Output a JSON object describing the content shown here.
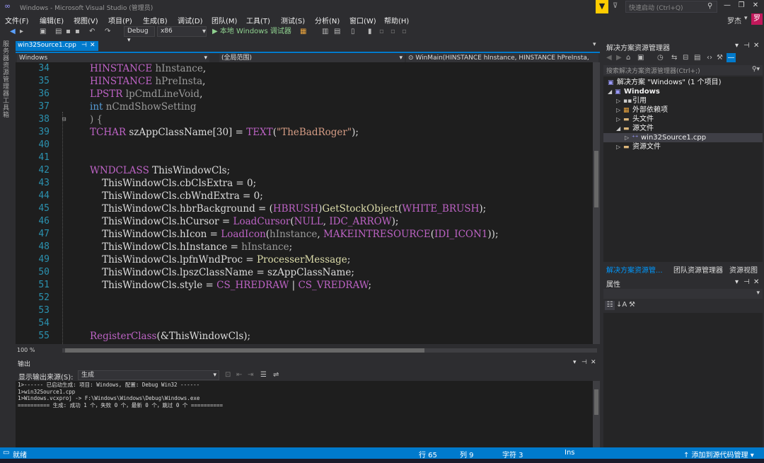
{
  "window": {
    "title": "Windows - Microsoft Visual Studio (管理员)",
    "quick_launch_placeholder": "快速启动 (Ctrl+Q)",
    "user_name": "罗杰",
    "avatar_letter": "罗"
  },
  "menu": [
    "文件(F)",
    "编辑(E)",
    "视图(V)",
    "项目(P)",
    "生成(B)",
    "调试(D)",
    "团队(M)",
    "工具(T)",
    "测试(S)",
    "分析(N)",
    "窗口(W)",
    "帮助(H)"
  ],
  "toolbar": {
    "config": "Debug",
    "platform": "x86",
    "run_label": "▶ 本地 Windows 调试器"
  },
  "left_strip_label": "服务器资源管理器工具箱",
  "editor": {
    "tab_name": "win32Source1.cpp",
    "nav_project": "Windows",
    "nav_scope": "(全局范围)",
    "nav_function": "WinMain(HINSTANCE hInstance, HINSTANCE hPreInsta,",
    "zoom": "100 %",
    "lines": [
      {
        "n": "34",
        "tokens": [
          {
            "t": "HINSTANCE",
            "c": "mac"
          },
          {
            "t": " "
          },
          {
            "t": "hInstance",
            "c": "par"
          },
          {
            "t": ","
          }
        ]
      },
      {
        "n": "35",
        "tokens": [
          {
            "t": "HINSTANCE",
            "c": "mac"
          },
          {
            "t": " "
          },
          {
            "t": "hPreInsta",
            "c": "par"
          },
          {
            "t": ","
          }
        ]
      },
      {
        "n": "36",
        "tokens": [
          {
            "t": "LPSTR",
            "c": "mac"
          },
          {
            "t": " "
          },
          {
            "t": "lpCmdLineVoid",
            "c": "par"
          },
          {
            "t": ","
          }
        ]
      },
      {
        "n": "37",
        "tokens": [
          {
            "t": "int",
            "c": "kw"
          },
          {
            "t": " "
          },
          {
            "t": "nCmdShowSetting",
            "c": "par"
          }
        ]
      },
      {
        "n": "38",
        "tokens": [
          {
            "t": ") {",
            "c": "par"
          }
        ]
      },
      {
        "n": "39",
        "tokens": [
          {
            "t": "TCHAR",
            "c": "mac"
          },
          {
            "t": " szAppClassName[30] = "
          },
          {
            "t": "TEXT",
            "c": "mac"
          },
          {
            "t": "("
          },
          {
            "t": "\"TheBadRoger\"",
            "c": "str"
          },
          {
            "t": ");"
          }
        ]
      },
      {
        "n": "40",
        "tokens": []
      },
      {
        "n": "41",
        "tokens": []
      },
      {
        "n": "42",
        "tokens": [
          {
            "t": "WNDCLASS",
            "c": "mac"
          },
          {
            "t": " ThisWindowCls;"
          }
        ]
      },
      {
        "n": "43",
        "tokens": [
          {
            "t": "    ThisWindowCls.cbClsExtra = 0;"
          }
        ]
      },
      {
        "n": "44",
        "tokens": [
          {
            "t": "    ThisWindowCls.cbWndExtra = 0;"
          }
        ]
      },
      {
        "n": "45",
        "tokens": [
          {
            "t": "    ThisWindowCls.hbrBackground = ("
          },
          {
            "t": "HBRUSH",
            "c": "mac"
          },
          {
            "t": ")"
          },
          {
            "t": "GetStockObject",
            "c": "fn"
          },
          {
            "t": "("
          },
          {
            "t": "WHITE_BRUSH",
            "c": "mac"
          },
          {
            "t": ");"
          }
        ]
      },
      {
        "n": "46",
        "tokens": [
          {
            "t": "    ThisWindowCls.hCursor = "
          },
          {
            "t": "LoadCursor",
            "c": "mac"
          },
          {
            "t": "("
          },
          {
            "t": "NULL",
            "c": "mac"
          },
          {
            "t": ", "
          },
          {
            "t": "IDC_ARROW",
            "c": "mac"
          },
          {
            "t": ");"
          }
        ]
      },
      {
        "n": "47",
        "tokens": [
          {
            "t": "    ThisWindowCls.hIcon = "
          },
          {
            "t": "LoadIcon",
            "c": "mac"
          },
          {
            "t": "("
          },
          {
            "t": "hInstance",
            "c": "par"
          },
          {
            "t": ", "
          },
          {
            "t": "MAKEINTRESOURCE",
            "c": "mac"
          },
          {
            "t": "("
          },
          {
            "t": "IDI_ICON1",
            "c": "mac"
          },
          {
            "t": "));"
          }
        ]
      },
      {
        "n": "48",
        "tokens": [
          {
            "t": "    ThisWindowCls.hInstance = "
          },
          {
            "t": "hInstance",
            "c": "par"
          },
          {
            "t": ";"
          }
        ]
      },
      {
        "n": "49",
        "tokens": [
          {
            "t": "    ThisWindowCls.lpfnWndProc = "
          },
          {
            "t": "ProcesserMessage",
            "c": "fn"
          },
          {
            "t": ";"
          }
        ]
      },
      {
        "n": "50",
        "tokens": [
          {
            "t": "    ThisWindowCls.lpszClassName = szAppClassName;"
          }
        ]
      },
      {
        "n": "51",
        "tokens": [
          {
            "t": "    ThisWindowCls.style = "
          },
          {
            "t": "CS_HREDRAW",
            "c": "mac"
          },
          {
            "t": " | "
          },
          {
            "t": "CS_VREDRAW",
            "c": "mac"
          },
          {
            "t": ";"
          }
        ]
      },
      {
        "n": "52",
        "tokens": []
      },
      {
        "n": "53",
        "tokens": []
      },
      {
        "n": "54",
        "tokens": []
      },
      {
        "n": "55",
        "tokens": [
          {
            "t": "RegisterClass",
            "c": "mac"
          },
          {
            "t": "(&ThisWindowCls);"
          }
        ]
      }
    ]
  },
  "output": {
    "title": "输出",
    "source_label": "显示输出来源(S):",
    "source_value": "生成",
    "lines": [
      "1>------ 已启动生成: 项目: Windows, 配置: Debug Win32 ------",
      "1>win32Source1.cpp",
      "1>Windows.vcxproj -> F:\\Windows\\Windows\\Debug\\Windows.exe",
      "========== 生成: 成功 1 个，失败 0 个，最新 0 个，跳过 0 个 =========="
    ]
  },
  "solution_explorer": {
    "title": "解决方案资源管理器",
    "search_placeholder": "搜索解决方案资源管理器(Ctrl+;)",
    "tree": [
      {
        "label": "解决方案 \"Windows\" (1 个项目)",
        "icon": "solution-icon"
      },
      {
        "label": "Windows",
        "icon": "project-icon"
      },
      {
        "label": "引用",
        "icon": "references-icon"
      },
      {
        "label": "外部依赖项",
        "icon": "external-deps-icon"
      },
      {
        "label": "头文件",
        "icon": "folder-icon"
      },
      {
        "label": "源文件",
        "icon": "folder-icon"
      },
      {
        "label": "win32Source1.cpp",
        "icon": "cpp-file-icon"
      },
      {
        "label": "资源文件",
        "icon": "folder-icon"
      }
    ],
    "tabs": [
      "解决方案资源管...",
      "团队资源管理器",
      "资源视图"
    ]
  },
  "properties": {
    "title": "属性"
  },
  "status": {
    "ready": "就绪",
    "line": "行 65",
    "col": "列 9",
    "char": "字符 3",
    "mode": "Ins",
    "source_control": "↑ 添加到源代码管理 ▾"
  },
  "colors": {
    "accent": "#007acc",
    "editor_bg": "#1e1e1e",
    "chrome_bg": "#2d2d30"
  }
}
